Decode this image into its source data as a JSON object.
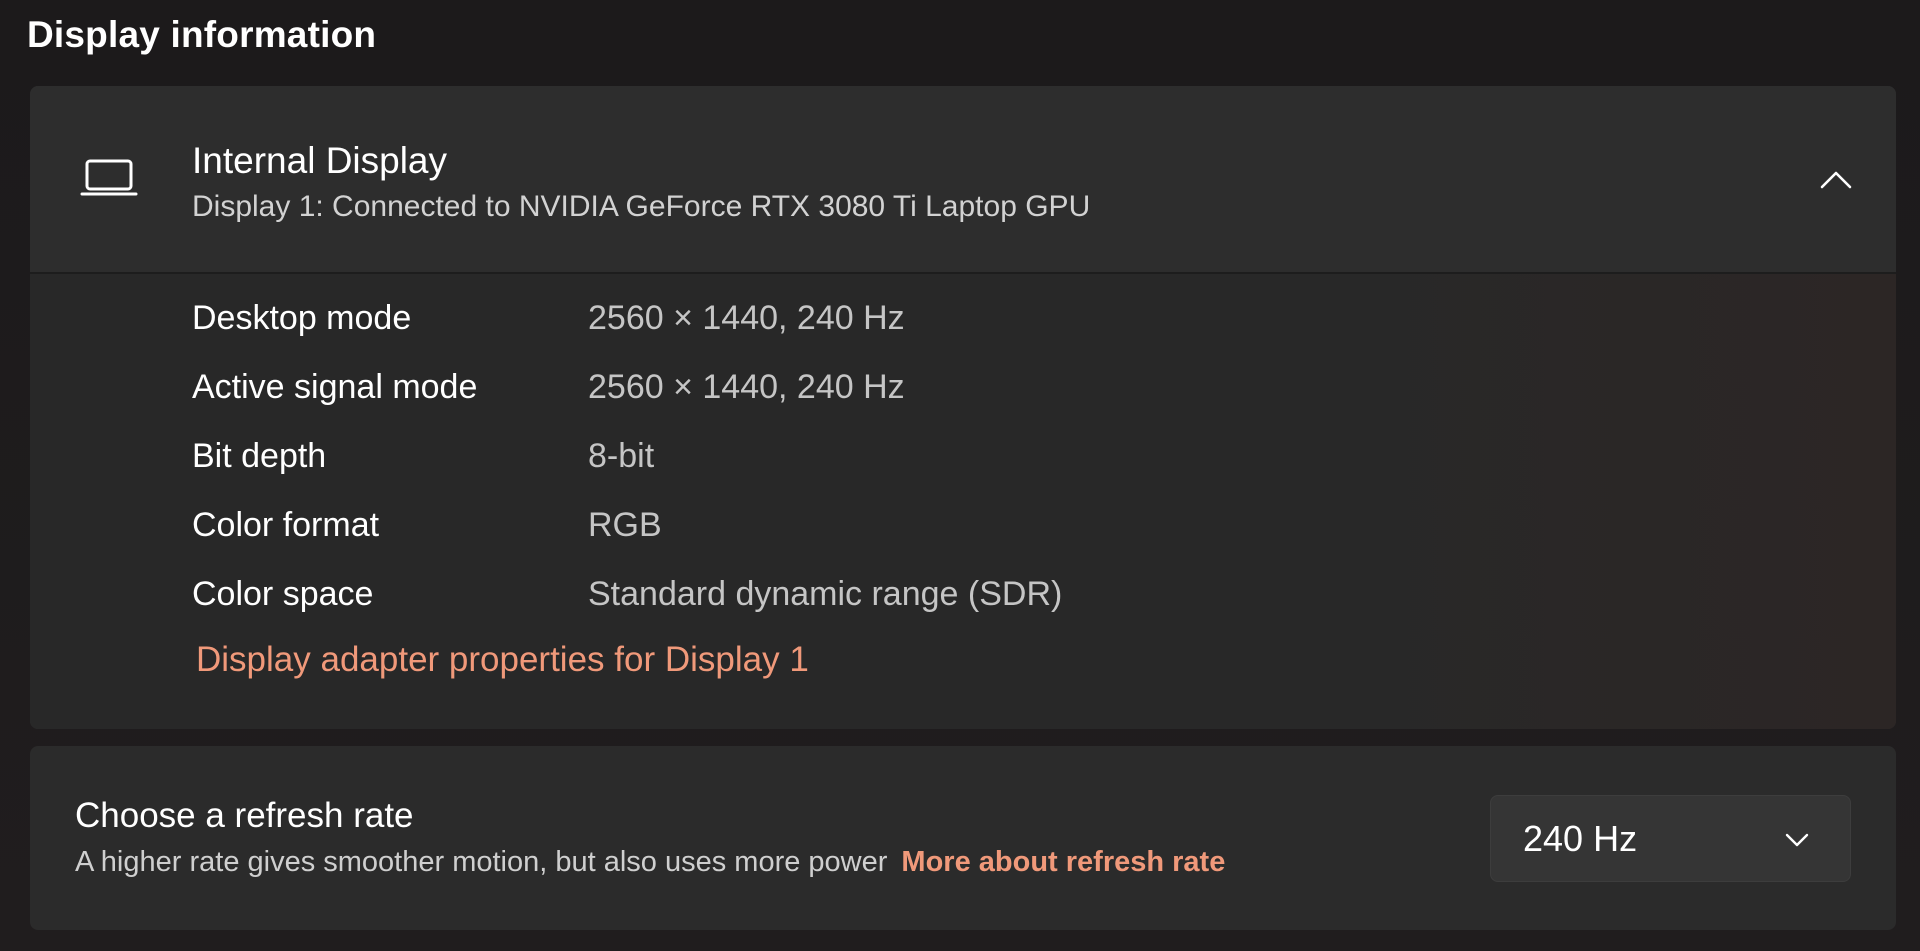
{
  "section": {
    "title": "Display information"
  },
  "display": {
    "icon": "laptop-icon",
    "title": "Internal Display",
    "subtitle": "Display 1: Connected to NVIDIA GeForce RTX 3080 Ti Laptop GPU",
    "expanded": true,
    "info": [
      {
        "label": "Desktop mode",
        "value": "2560 × 1440, 240 Hz"
      },
      {
        "label": "Active signal mode",
        "value": "2560 × 1440, 240 Hz"
      },
      {
        "label": "Bit depth",
        "value": "8-bit"
      },
      {
        "label": "Color format",
        "value": "RGB"
      },
      {
        "label": "Color space",
        "value": "Standard dynamic range (SDR)"
      }
    ],
    "adapter_link": "Display adapter properties for Display 1"
  },
  "refresh": {
    "title": "Choose a refresh rate",
    "description": "A higher rate gives smoother motion, but also uses more power",
    "link": "More about refresh rate",
    "selected": "240 Hz"
  },
  "colors": {
    "accent": "#f0997a",
    "card": "#2b2b2b",
    "background": "#1e1c1d"
  }
}
